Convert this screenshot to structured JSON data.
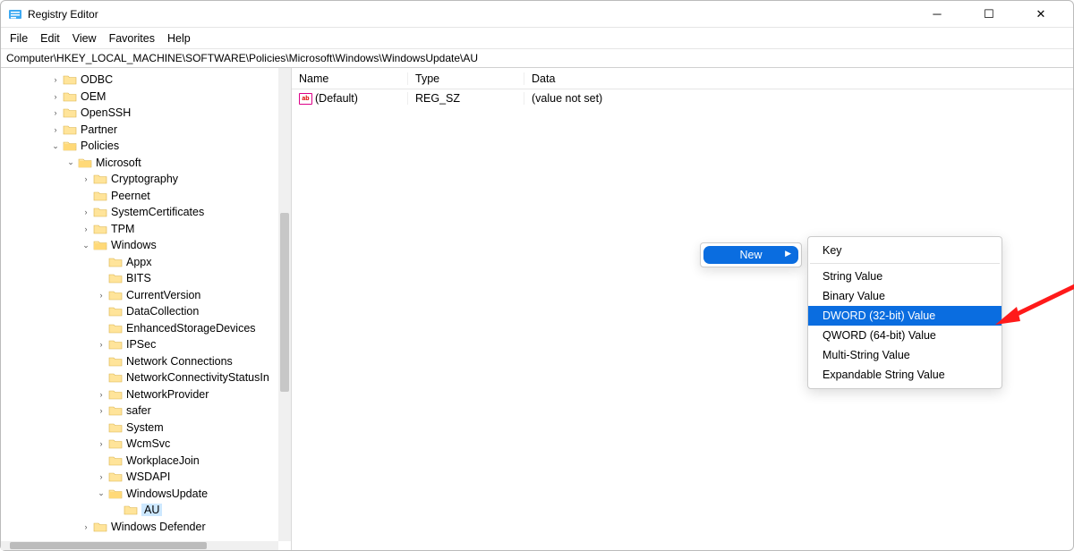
{
  "window": {
    "title": "Registry Editor"
  },
  "menu": {
    "file": "File",
    "edit": "Edit",
    "view": "View",
    "favorites": "Favorites",
    "help": "Help"
  },
  "address": "Computer\\HKEY_LOCAL_MACHINE\\SOFTWARE\\Policies\\Microsoft\\Windows\\WindowsUpdate\\AU",
  "tree": [
    {
      "indent": 3,
      "chev": ">",
      "label": "ODBC"
    },
    {
      "indent": 3,
      "chev": ">",
      "label": "OEM"
    },
    {
      "indent": 3,
      "chev": ">",
      "label": "OpenSSH"
    },
    {
      "indent": 3,
      "chev": ">",
      "label": "Partner"
    },
    {
      "indent": 3,
      "chev": "v",
      "label": "Policies"
    },
    {
      "indent": 4,
      "chev": "v",
      "label": "Microsoft"
    },
    {
      "indent": 5,
      "chev": ">",
      "label": "Cryptography"
    },
    {
      "indent": 5,
      "chev": "",
      "label": "Peernet"
    },
    {
      "indent": 5,
      "chev": ">",
      "label": "SystemCertificates"
    },
    {
      "indent": 5,
      "chev": ">",
      "label": "TPM"
    },
    {
      "indent": 5,
      "chev": "v",
      "label": "Windows"
    },
    {
      "indent": 6,
      "chev": "",
      "label": "Appx"
    },
    {
      "indent": 6,
      "chev": "",
      "label": "BITS"
    },
    {
      "indent": 6,
      "chev": ">",
      "label": "CurrentVersion"
    },
    {
      "indent": 6,
      "chev": "",
      "label": "DataCollection"
    },
    {
      "indent": 6,
      "chev": "",
      "label": "EnhancedStorageDevices"
    },
    {
      "indent": 6,
      "chev": ">",
      "label": "IPSec"
    },
    {
      "indent": 6,
      "chev": "",
      "label": "Network Connections"
    },
    {
      "indent": 6,
      "chev": "",
      "label": "NetworkConnectivityStatusIn"
    },
    {
      "indent": 6,
      "chev": ">",
      "label": "NetworkProvider"
    },
    {
      "indent": 6,
      "chev": ">",
      "label": "safer"
    },
    {
      "indent": 6,
      "chev": "",
      "label": "System"
    },
    {
      "indent": 6,
      "chev": ">",
      "label": "WcmSvc"
    },
    {
      "indent": 6,
      "chev": "",
      "label": "WorkplaceJoin"
    },
    {
      "indent": 6,
      "chev": ">",
      "label": "WSDAPI"
    },
    {
      "indent": 6,
      "chev": "v",
      "label": "WindowsUpdate"
    },
    {
      "indent": 7,
      "chev": "",
      "label": "AU",
      "selected": true
    },
    {
      "indent": 5,
      "chev": ">",
      "label": "Windows Defender"
    }
  ],
  "columns": {
    "name": "Name",
    "type": "Type",
    "data": "Data"
  },
  "rows": [
    {
      "name": "(Default)",
      "type": "REG_SZ",
      "data": "(value not set)"
    }
  ],
  "context1": {
    "new": "New"
  },
  "context2": {
    "key": "Key",
    "string": "String Value",
    "binary": "Binary Value",
    "dword": "DWORD (32-bit) Value",
    "qword": "QWORD (64-bit) Value",
    "multistring": "Multi-String Value",
    "expandable": "Expandable String Value"
  }
}
